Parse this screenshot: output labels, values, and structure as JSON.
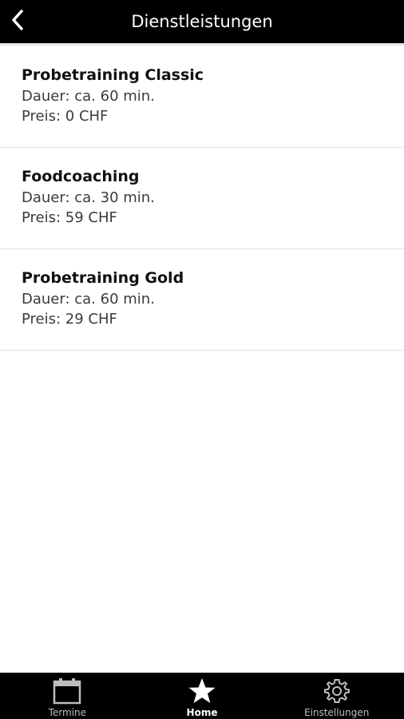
{
  "header": {
    "title": "Dienstleistungen",
    "back_icon": "chevron-left-icon"
  },
  "services": [
    {
      "title": "Probetraining Classic",
      "dauer": "Dauer: ca. 60 min.",
      "preis": "Preis: 0 CHF"
    },
    {
      "title": "Foodcoaching",
      "dauer": "Dauer: ca. 30 min.",
      "preis": "Preis: 59 CHF"
    },
    {
      "title": "Probetraining Gold",
      "dauer": "Dauer: ca. 60 min.",
      "preis": "Preis: 29 CHF"
    }
  ],
  "tabbar": {
    "tabs": [
      {
        "label": "Termine",
        "icon": "calendar-icon",
        "active": false
      },
      {
        "label": "Home",
        "icon": "star-icon",
        "active": true
      },
      {
        "label": "Einstellungen",
        "icon": "gear-icon",
        "active": false
      }
    ]
  },
  "colors": {
    "bar_background": "#000000",
    "active_tab": "#ffffff",
    "inactive_tab": "#bdbdbd"
  }
}
